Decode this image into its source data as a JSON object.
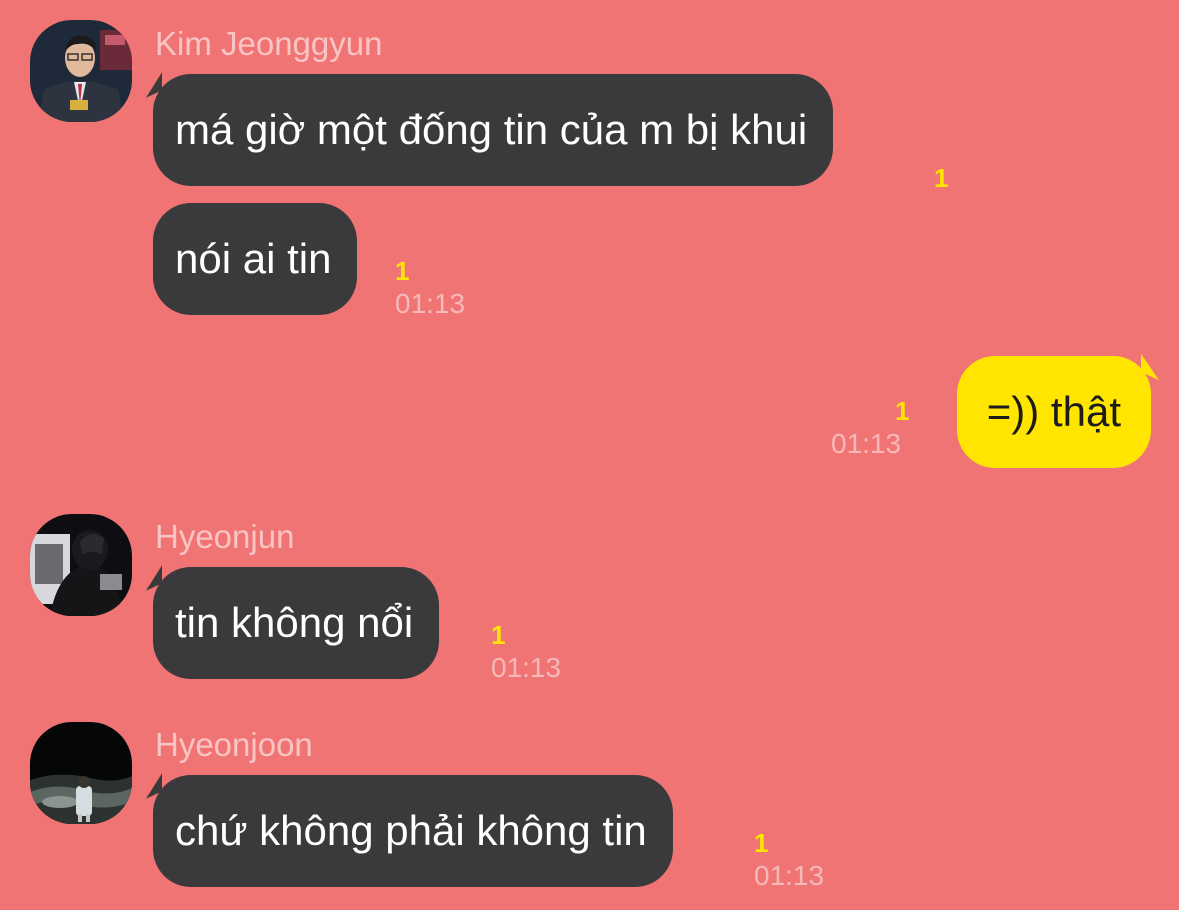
{
  "messages": [
    {
      "sender": "Kim Jeonggyun",
      "avatar_icon": "profile-photo-man-in-suit",
      "bubbles": [
        {
          "text": "má giờ một đống tin của m bị khui",
          "unread": "1",
          "time": ""
        },
        {
          "text": "nói ai tin",
          "unread": "1",
          "time": "01:13"
        }
      ]
    },
    {
      "sender": "",
      "outgoing": true,
      "bubbles": [
        {
          "text": "=)) thật",
          "unread": "1",
          "time": "01:13"
        }
      ]
    },
    {
      "sender": "Hyeonjun",
      "avatar_icon": "profile-photo-hooded-person",
      "bubbles": [
        {
          "text": "tin không nổi",
          "unread": "1",
          "time": "01:13"
        }
      ]
    },
    {
      "sender": "Hyeonjoon",
      "avatar_icon": "profile-photo-person-at-night-sea",
      "bubbles": [
        {
          "text": "chứ không phải không tin",
          "unread": "1",
          "time": "01:13"
        }
      ]
    }
  ],
  "colors": {
    "background": "#f07474",
    "incoming_bubble": "#3a3a3c",
    "outgoing_bubble": "#ffe500",
    "unread_count": "#ffe500"
  }
}
